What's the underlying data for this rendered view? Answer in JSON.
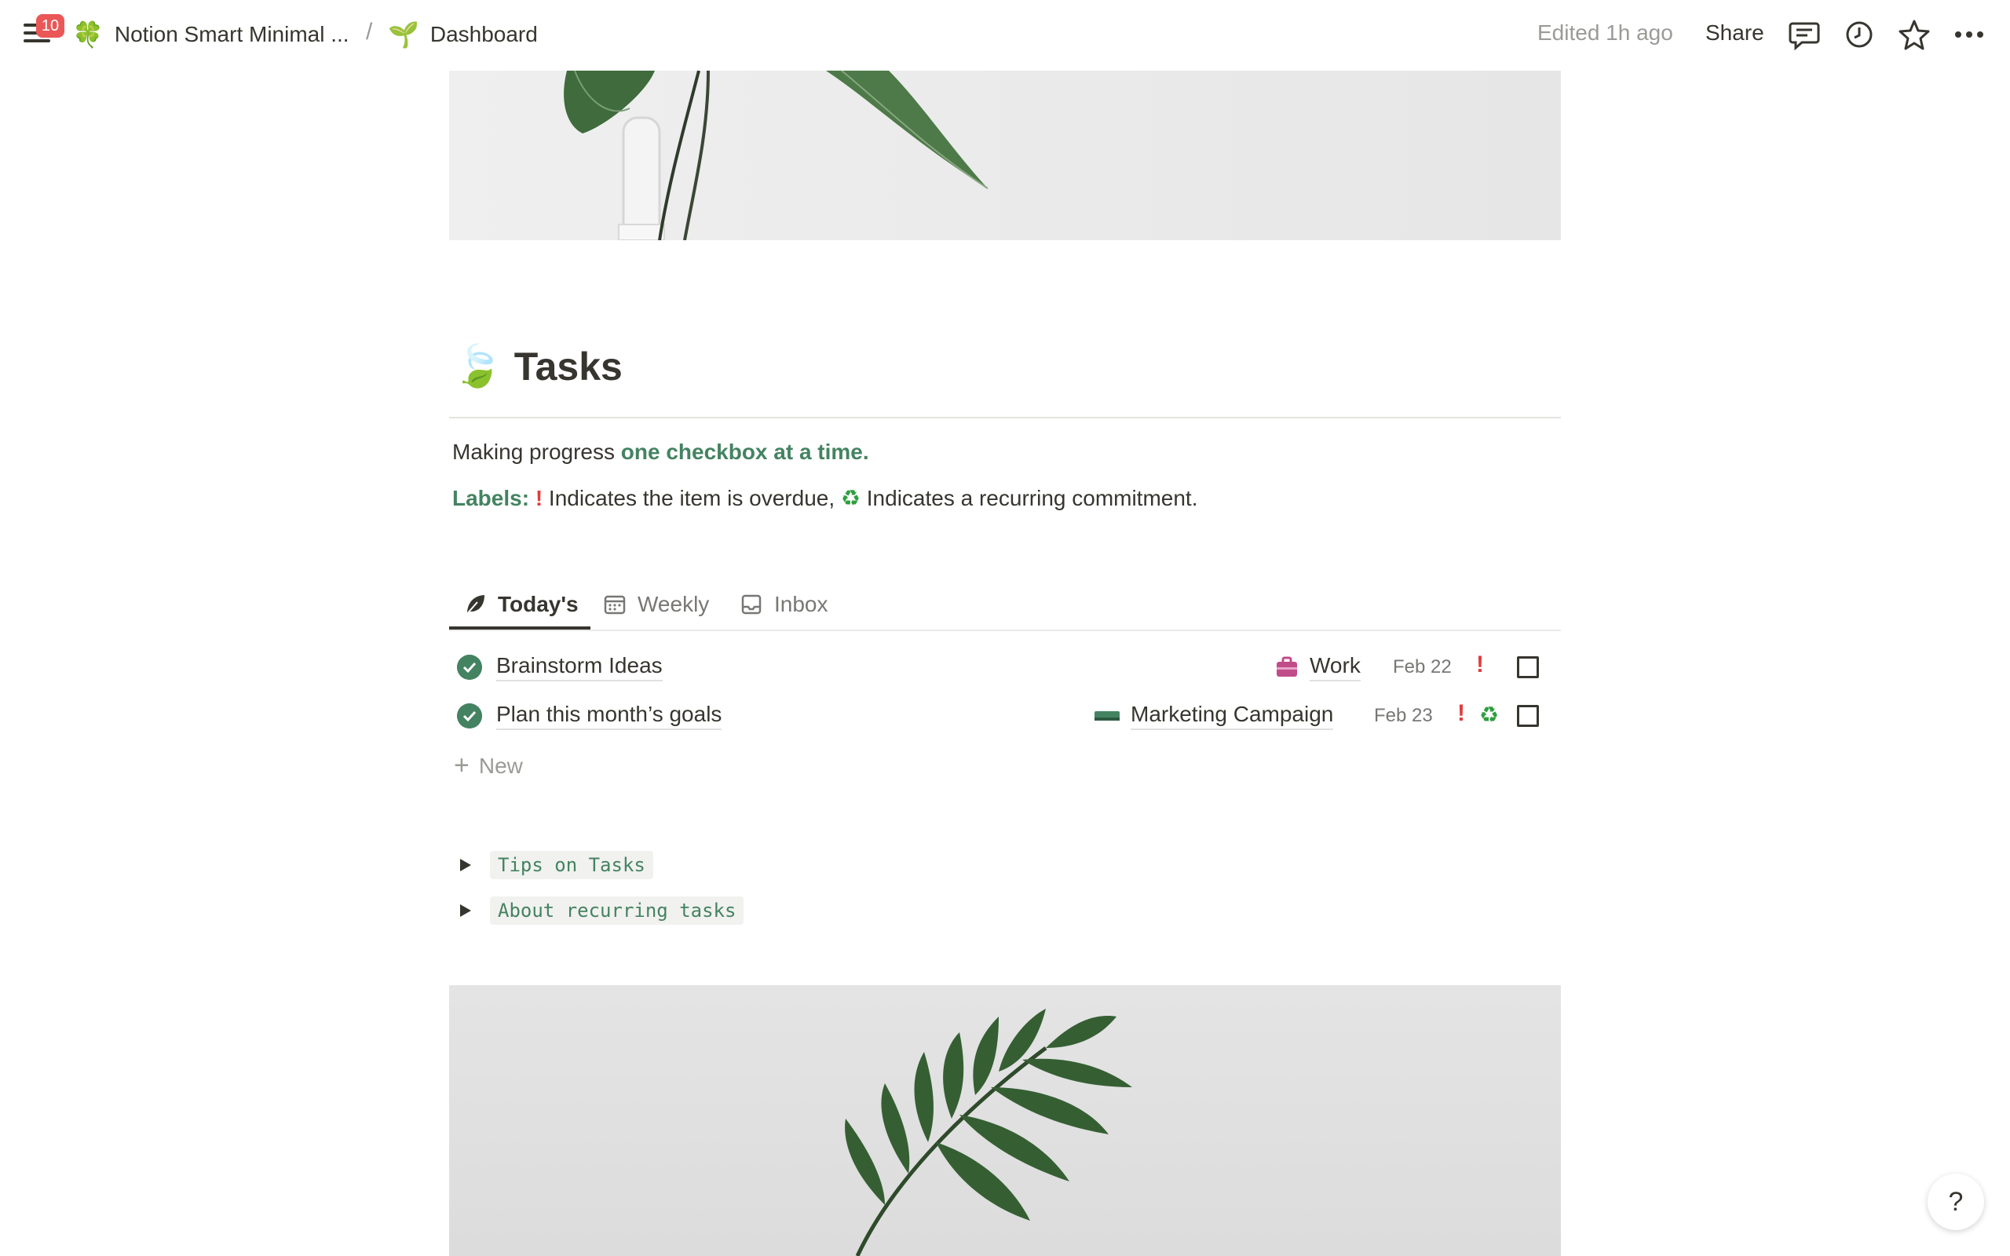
{
  "topbar": {
    "notification_count": "10",
    "breadcrumb": [
      {
        "emoji": "🍀",
        "label": "Notion Smart Minimal ..."
      },
      {
        "emoji": "🌱",
        "label": "Dashboard"
      }
    ],
    "separator": "/",
    "edited": "Edited 1h ago",
    "share_label": "Share",
    "icons": [
      "comment-icon",
      "clock-icon",
      "star-icon",
      "more-icon"
    ]
  },
  "page": {
    "emoji": "🍃",
    "title": "Tasks",
    "intro_text": "Making progress ",
    "intro_highlight": "one checkbox at a time.",
    "labels_title": "Labels:",
    "overdue_mark": "!",
    "overdue_text": " Indicates the item is overdue, ",
    "recurring_mark": "♻",
    "recurring_text": " Indicates a recurring commitment."
  },
  "tabs": [
    {
      "label": "Today's",
      "icon": "leaf-icon",
      "active": true
    },
    {
      "label": "Weekly",
      "icon": "calendar-icon",
      "active": false
    },
    {
      "label": "Inbox",
      "icon": "inbox-icon",
      "active": false
    }
  ],
  "tasks": [
    {
      "title": "Brainstorm Ideas",
      "tag_icon": "briefcase-icon",
      "tag": "Work",
      "date": "Feb 22",
      "overdue": "!",
      "recurring": "",
      "checked": false
    },
    {
      "title": "Plan this month’s goals",
      "tag_icon": "campaign-icon",
      "tag": "Marketing Campaign",
      "date": "Feb 23",
      "overdue": "!",
      "recurring": "♻",
      "checked": false
    }
  ],
  "new_label": "New",
  "new_icon": "+",
  "toggles": [
    {
      "label": "Tips on Tasks"
    },
    {
      "label": "About recurring tasks"
    }
  ],
  "help_label": "?",
  "colors": {
    "accent_green": "#448361",
    "overdue_red": "#e03e3e",
    "text": "#37352f",
    "muted": "#9b9a97"
  }
}
